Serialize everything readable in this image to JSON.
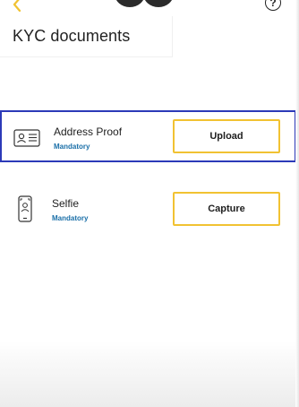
{
  "header": {
    "title": "KYC documents",
    "help_glyph": "?",
    "back_icon": "chevron-left-icon",
    "help_icon": "question-circle-icon",
    "accent_color": "#f1c232"
  },
  "documents": [
    {
      "label": "Address Proof",
      "status": "Mandatory",
      "action": "Upload",
      "icon": "id-card-icon",
      "selected": true
    },
    {
      "label": "Selfie",
      "status": "Mandatory",
      "action": "Capture",
      "icon": "phone-selfie-icon",
      "selected": false
    }
  ],
  "colors": {
    "selected_border": "#2c3ab8",
    "button_border": "#f1c232",
    "status_text": "#1a6fa8"
  }
}
